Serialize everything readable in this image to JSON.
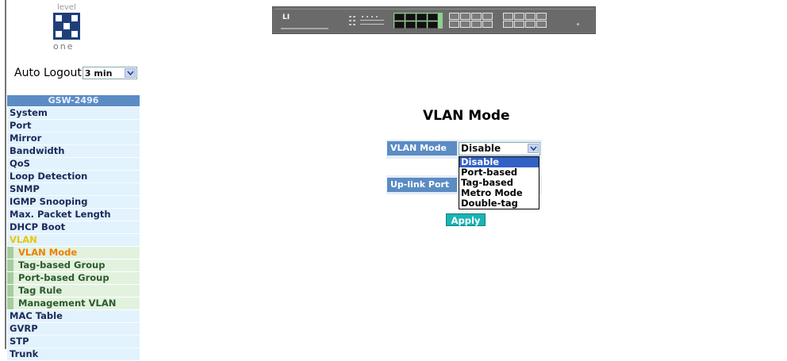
{
  "logo": {
    "top_text": "level",
    "bottom_text": "one"
  },
  "auto_logout": {
    "label": "Auto Logout",
    "value": "3 min"
  },
  "menu": {
    "header": "GSW-2496",
    "items": [
      {
        "label": "System"
      },
      {
        "label": "Port"
      },
      {
        "label": "Mirror"
      },
      {
        "label": "Bandwidth"
      },
      {
        "label": "QoS"
      },
      {
        "label": "Loop Detection"
      },
      {
        "label": "SNMP"
      },
      {
        "label": "IGMP Snooping"
      },
      {
        "label": "Max. Packet Length"
      },
      {
        "label": "DHCP Boot"
      },
      {
        "label": "VLAN"
      }
    ],
    "vlan_sub": [
      {
        "label": "VLAN Mode"
      },
      {
        "label": "Tag-based Group"
      },
      {
        "label": "Port-based Group"
      },
      {
        "label": "Tag Rule"
      },
      {
        "label": "Management VLAN"
      }
    ],
    "items_after": [
      {
        "label": "MAC Table"
      },
      {
        "label": "GVRP"
      },
      {
        "label": "STP"
      },
      {
        "label": "Trunk"
      }
    ]
  },
  "device": {
    "brand": "LI"
  },
  "main": {
    "title": "VLAN Mode",
    "vlan_mode_label": "VLAN Mode",
    "vlan_mode_value": "Disable",
    "uplink_label": "Up-link Port",
    "options": [
      "Disable",
      "Port-based",
      "Tag-based",
      "Metro Mode",
      "Double-tag"
    ],
    "apply_label": "Apply"
  },
  "colors": {
    "label_bg": "#5b8cc4",
    "apply_bg": "#1ab4b4",
    "selected_option": "#3160c6",
    "active_menu": "#e6c700",
    "current_submenu": "#ee7f00"
  }
}
